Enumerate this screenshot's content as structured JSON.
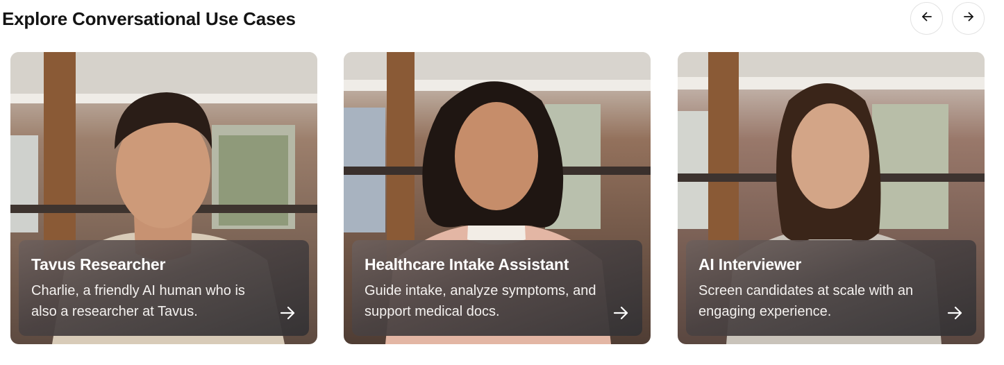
{
  "section": {
    "title": "Explore Conversational Use Cases"
  },
  "navigation": {
    "prev_icon": "arrow-left-icon",
    "next_icon": "arrow-right-icon"
  },
  "cards": [
    {
      "title": "Tavus Researcher",
      "description": "Charlie, a friendly AI human who is also a researcher at Tavus.",
      "icon": "arrow-right-icon"
    },
    {
      "title": "Healthcare Intake Assistant",
      "description": "Guide intake, analyze symptoms, and support medical docs.",
      "icon": "arrow-right-icon"
    },
    {
      "title": "AI Interviewer",
      "description": "Screen candidates at scale with an engaging experience.",
      "icon": "arrow-right-icon"
    }
  ],
  "colors": {
    "title_text": "#141414",
    "card_overlay": "#4a4242",
    "card_text": "#ffffff"
  }
}
